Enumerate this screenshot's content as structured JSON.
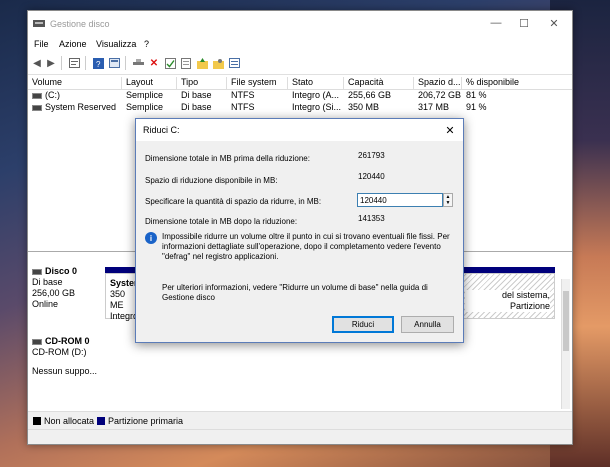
{
  "window": {
    "title": "Gestione disco",
    "minimize": "—",
    "maximize": "☐",
    "close": "✕"
  },
  "menu": [
    "File",
    "Azione",
    "Visualizza",
    "?"
  ],
  "columns": [
    "Volume",
    "Layout",
    "Tipo",
    "File system",
    "Stato",
    "Capacità",
    "Spazio d...",
    "% disponibile"
  ],
  "rows": [
    {
      "volume": "(C:)",
      "layout": "Semplice",
      "tipo": "Di base",
      "fs": "NTFS",
      "stato": "Integro (A...",
      "capacita": "255,66 GB",
      "spazio": "206,72 GB",
      "perc": "81 %"
    },
    {
      "volume": "System Reserved",
      "layout": "Semplice",
      "tipo": "Di base",
      "fs": "NTFS",
      "stato": "Integro (Si...",
      "capacita": "350 MB",
      "spazio": "317 MB",
      "perc": "91 %"
    }
  ],
  "disk0": {
    "name": "Disco 0",
    "type": "Di base",
    "size": "256,00 GB",
    "status": "Online",
    "vol1_name": "Syster",
    "vol1_size": "350 ME",
    "vol1_status": "Integro",
    "vol2_text": "del sistema, Partizione"
  },
  "cdrom": {
    "name": "CD-ROM 0",
    "label": "CD-ROM (D:)",
    "status": "Nessun suppo..."
  },
  "legend": {
    "unallocated": "Non allocata",
    "primary": "Partizione primaria",
    "unallocated_color": "#000000",
    "primary_color": "#00007b"
  },
  "dialog": {
    "title": "Riduci C:",
    "total_before_label": "Dimensione totale in MB prima della riduzione:",
    "total_before_value": "261793",
    "available_label": "Spazio di riduzione disponibile in MB:",
    "available_value": "120440",
    "amount_label": "Specificare la quantità di spazio da ridurre, in MB:",
    "amount_value": "120440",
    "total_after_label": "Dimensione totale in MB dopo la riduzione:",
    "total_after_value": "141353",
    "info_text": "Impossibile ridurre un volume oltre il punto in cui si trovano eventuali file fissi. Per informazioni dettagliate sull'operazione, dopo il completamento vedere l'evento \"defrag\" nel registro applicazioni.",
    "more_text": "Per ulteriori informazioni, vedere \"Ridurre un volume di base\" nella guida di Gestione disco",
    "ok_label": "Riduci",
    "cancel_label": "Annulla",
    "close": "✕"
  }
}
